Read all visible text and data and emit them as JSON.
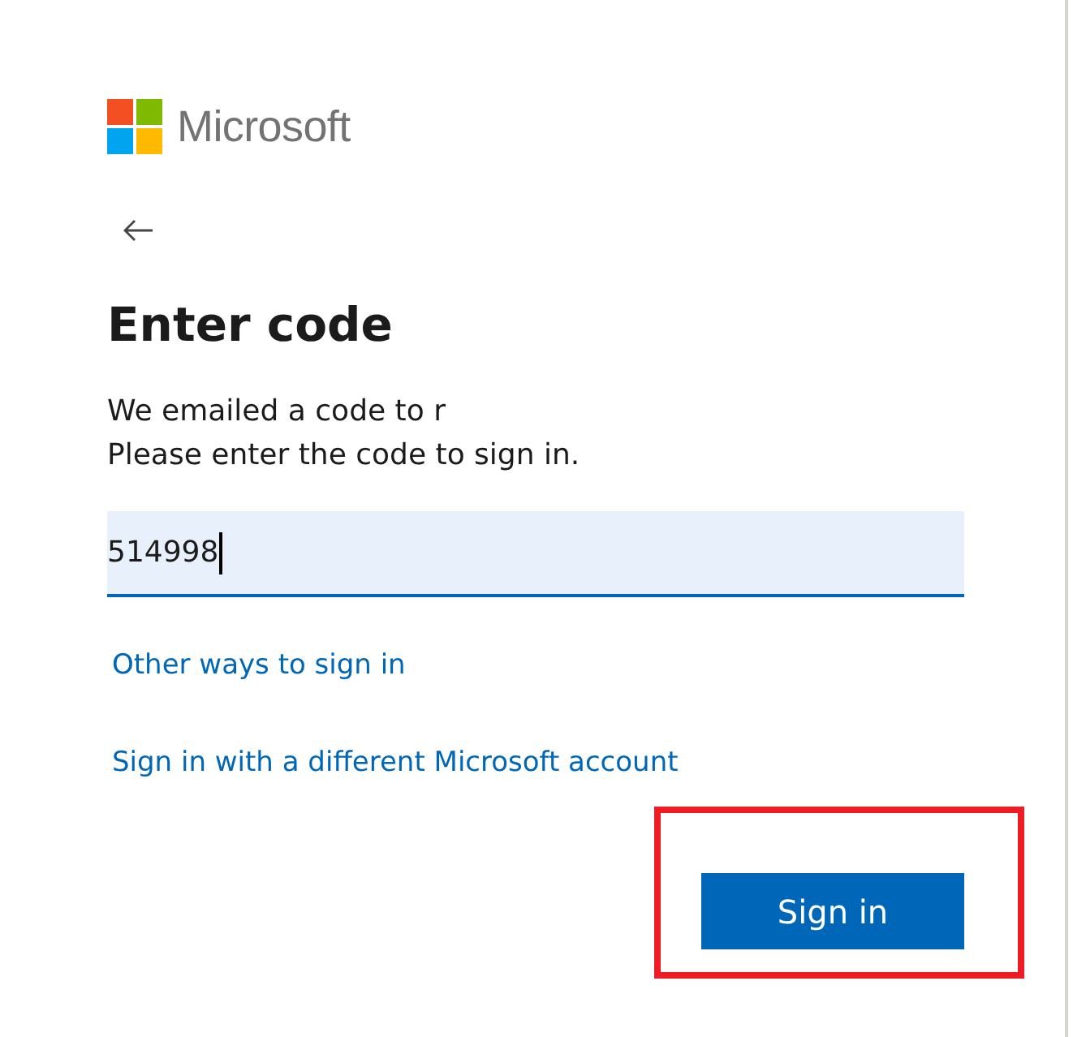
{
  "brand": {
    "name": "Microsoft"
  },
  "title": "Enter code",
  "message": [
    "We emailed a code to r",
    "Please enter the code to sign in."
  ],
  "code_field": {
    "value": "514998",
    "focused": true
  },
  "links": [
    "Other ways to sign in",
    "Sign in with a different Microsoft account"
  ],
  "primary_button": {
    "label": "Sign in",
    "highlighted": true
  }
}
